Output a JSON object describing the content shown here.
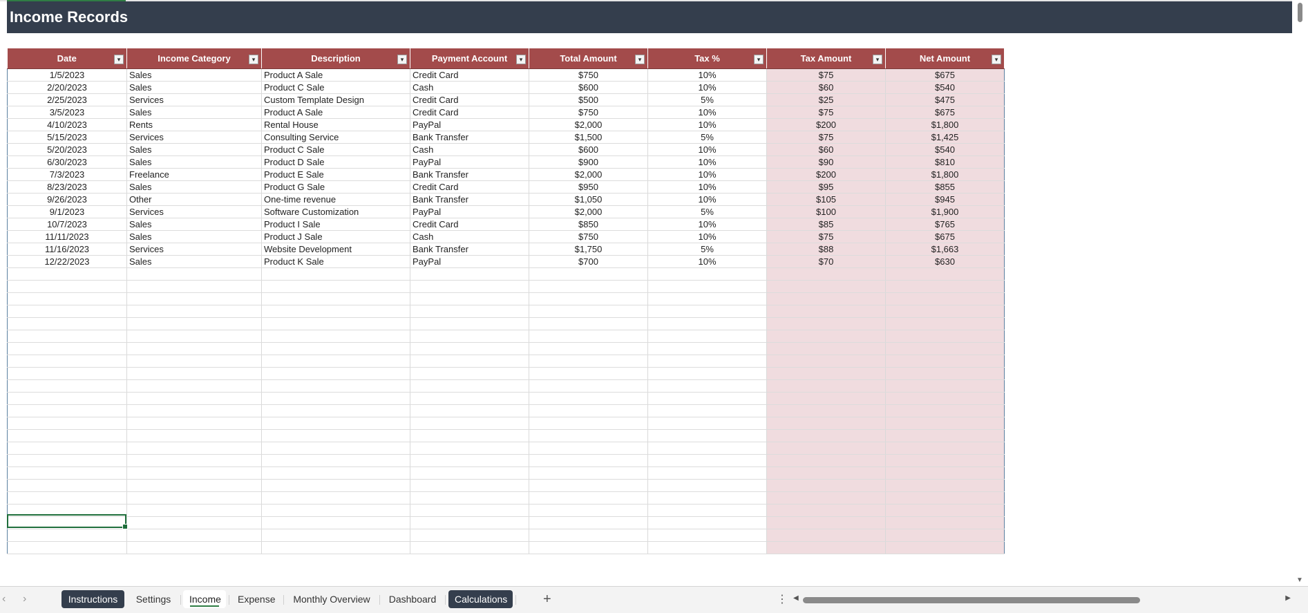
{
  "page": {
    "title": "Income Records"
  },
  "columns": [
    {
      "label": "Date",
      "align": "c",
      "pink": false
    },
    {
      "label": "Income Category",
      "align": "l",
      "pink": false
    },
    {
      "label": "Description",
      "align": "l",
      "pink": false
    },
    {
      "label": "Payment Account",
      "align": "l",
      "pink": false
    },
    {
      "label": "Total Amount",
      "align": "c",
      "pink": false
    },
    {
      "label": "Tax %",
      "align": "c",
      "pink": false
    },
    {
      "label": "Tax Amount",
      "align": "c",
      "pink": true
    },
    {
      "label": "Net Amount",
      "align": "c",
      "pink": true
    }
  ],
  "rows": [
    [
      "1/5/2023",
      "Sales",
      "Product A Sale",
      "Credit Card",
      "$750",
      "10%",
      "$75",
      "$675"
    ],
    [
      "2/20/2023",
      "Sales",
      "Product C Sale",
      "Cash",
      "$600",
      "10%",
      "$60",
      "$540"
    ],
    [
      "2/25/2023",
      "Services",
      "Custom Template Design",
      "Credit Card",
      "$500",
      "5%",
      "$25",
      "$475"
    ],
    [
      "3/5/2023",
      "Sales",
      "Product A Sale",
      "Credit Card",
      "$750",
      "10%",
      "$75",
      "$675"
    ],
    [
      "4/10/2023",
      "Rents",
      "Rental House",
      "PayPal",
      "$2,000",
      "10%",
      "$200",
      "$1,800"
    ],
    [
      "5/15/2023",
      "Services",
      "Consulting Service",
      "Bank Transfer",
      "$1,500",
      "5%",
      "$75",
      "$1,425"
    ],
    [
      "5/20/2023",
      "Sales",
      "Product C Sale",
      "Cash",
      "$600",
      "10%",
      "$60",
      "$540"
    ],
    [
      "6/30/2023",
      "Sales",
      "Product D Sale",
      "PayPal",
      "$900",
      "10%",
      "$90",
      "$810"
    ],
    [
      "7/3/2023",
      "Freelance",
      "Product E Sale",
      "Bank Transfer",
      "$2,000",
      "10%",
      "$200",
      "$1,800"
    ],
    [
      "8/23/2023",
      "Sales",
      "Product G Sale",
      "Credit Card",
      "$950",
      "10%",
      "$95",
      "$855"
    ],
    [
      "9/26/2023",
      "Other",
      "One-time revenue",
      "Bank Transfer",
      "$1,050",
      "10%",
      "$105",
      "$945"
    ],
    [
      "9/1/2023",
      "Services",
      "Software Customization",
      "PayPal",
      "$2,000",
      "5%",
      "$100",
      "$1,900"
    ],
    [
      "10/7/2023",
      "Sales",
      "Product I Sale",
      "Credit Card",
      "$850",
      "10%",
      "$85",
      "$765"
    ],
    [
      "11/11/2023",
      "Sales",
      "Product J Sale",
      "Cash",
      "$750",
      "10%",
      "$75",
      "$675"
    ],
    [
      "11/16/2023",
      "Services",
      "Website Development",
      "Bank Transfer",
      "$1,750",
      "5%",
      "$88",
      "$1,663"
    ],
    [
      "12/22/2023",
      "Sales",
      "Product K Sale",
      "PayPal",
      "$700",
      "10%",
      "$70",
      "$630"
    ]
  ],
  "filter_glyph": "▾",
  "tabs": [
    {
      "label": "Instructions",
      "style": "dark"
    },
    {
      "label": "Settings",
      "style": "plain"
    },
    {
      "label": "Income",
      "style": "active"
    },
    {
      "label": "Expense",
      "style": "plain"
    },
    {
      "label": "Monthly Overview",
      "style": "plain"
    },
    {
      "label": "Dashboard",
      "style": "plain"
    },
    {
      "label": "Calculations",
      "style": "dark"
    }
  ],
  "colors": {
    "header": "#a34b4b",
    "banner": "#343e4d",
    "pink": "#f0dcdf",
    "accent": "#2f7d44"
  }
}
